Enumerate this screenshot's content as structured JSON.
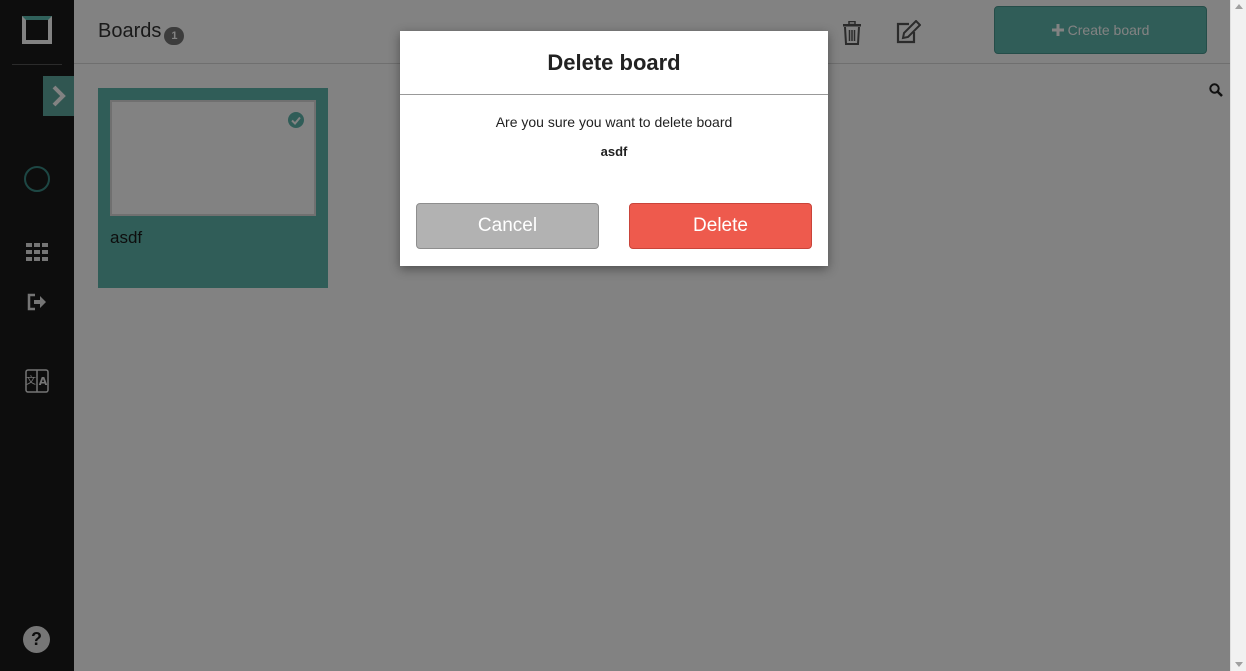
{
  "header": {
    "title": "Boards",
    "board_count": "1",
    "create_label": "Create board",
    "create_icon": "plus-icon",
    "delete_icon": "trash-icon",
    "edit_icon": "edit-icon",
    "search_icon": "search-icon"
  },
  "sidebar": {
    "icons": [
      "app-logo-icon",
      "chevron-right-icon",
      "user-avatar-icon",
      "grid-icon",
      "logout-icon",
      "language-icon",
      "help-icon"
    ]
  },
  "boards": [
    {
      "name": "asdf",
      "selected": true
    }
  ],
  "dialog": {
    "title": "Delete board",
    "message": "Are you sure you want to delete board",
    "board_name": "asdf",
    "cancel_label": "Cancel",
    "delete_label": "Delete"
  },
  "colors": {
    "accent": "#5fb7ad",
    "danger": "#ee5a4d",
    "sidebar": "#1b1b1b",
    "cancel": "#b2b2b2"
  }
}
